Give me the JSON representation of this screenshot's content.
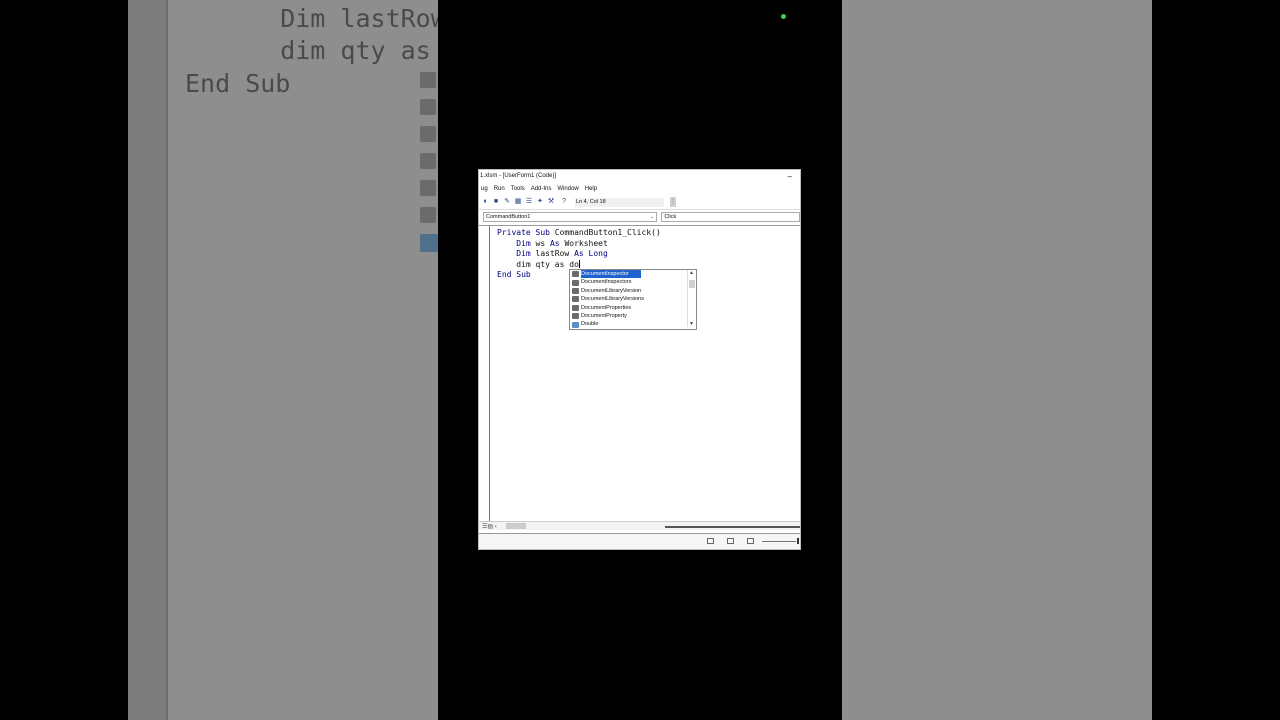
{
  "background": {
    "code_lines": [
      "    Dim lastRow",
      "    dim qty as",
      "End Sub"
    ]
  },
  "window": {
    "title": "1.xlsm - [UserForm1 (Code)]",
    "menu": [
      "ug",
      "Run",
      "Tools",
      "Add-Ins",
      "Window",
      "Help"
    ],
    "status_position": "Ln 4, Col 18",
    "object_combo": "CommandButton1",
    "procedure_combo": "Click"
  },
  "code": {
    "line1_kw": "Private Sub",
    "line1_rest": " CommandButton1_Click()",
    "line2_kw": "    Dim",
    "line2_rest": " ws ",
    "line2_kw2": "As",
    "line2_rest2": " Worksheet",
    "line3_kw": "    Dim",
    "line3_rest": " lastRow ",
    "line3_kw2": "As Long",
    "line4": "    dim qty as do",
    "line5": "End Sub"
  },
  "autocomplete": {
    "items": [
      "DocumentInspector",
      "DocumentInspectors",
      "DocumentLibraryVersion",
      "DocumentLibraryVersions",
      "DocumentProperties",
      "DocumentProperty",
      "Double"
    ],
    "selected_index": 0
  },
  "colors": {
    "keyword": "#00007f",
    "selection": "#1e62d0"
  }
}
